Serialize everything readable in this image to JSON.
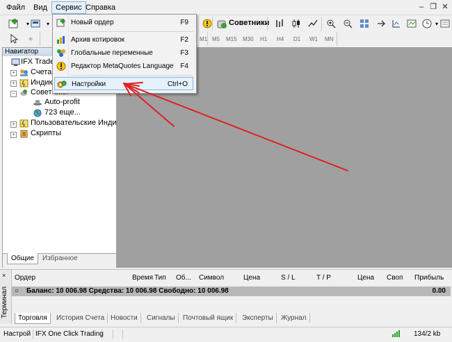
{
  "menubar": {
    "items": [
      "Файл",
      "Вид",
      "Сервис",
      "Справка"
    ]
  },
  "toolbar": {
    "experts_label": "Советники",
    "timeframes": [
      "M1",
      "M5",
      "M15",
      "M30",
      "H1",
      "H4",
      "D1",
      "W1",
      "MN"
    ]
  },
  "service_menu": {
    "items": [
      {
        "label": "Новый ордер",
        "shortcut": "F9",
        "icon": "new-order-icon"
      },
      {
        "label": "Архив котировок",
        "shortcut": "F2",
        "icon": "history-icon"
      },
      {
        "label": "Глобальные переменные",
        "shortcut": "F3",
        "icon": "global-vars-icon"
      },
      {
        "label": "Редактор MetaQuotes Language",
        "shortcut": "F4",
        "icon": "metaeditor-icon"
      },
      {
        "label": "Настройки",
        "shortcut": "Ctrl+O",
        "icon": "settings-icon"
      }
    ]
  },
  "navigator": {
    "title": "Навигатор",
    "tree": [
      {
        "label": "IFX Trader"
      },
      {
        "label": "Счета"
      },
      {
        "label": "Индик"
      },
      {
        "label": "Советники"
      },
      {
        "label": "Auto-profit"
      },
      {
        "label": "723 еще..."
      },
      {
        "label": "Пользовательские Индика"
      },
      {
        "label": "Скрипты"
      }
    ],
    "tabs": [
      "Общие",
      "Избранное"
    ]
  },
  "terminal": {
    "side_label": "Терминал",
    "columns": [
      "Ордер",
      "Время",
      "Тип",
      "Об...",
      "Символ",
      "Цена",
      "S / L",
      "T / P",
      "Цена",
      "Своп",
      "Прибыль"
    ],
    "balance_text": "Баланс: 10 006.98  Средства: 10 006.98  Свободно: 10 006.98",
    "balance_profit": "0.00",
    "tabs": [
      "Торговля",
      "История Счета",
      "Новости",
      "Сигналы",
      "Почтовый ящик",
      "Эксперты",
      "Журнал"
    ]
  },
  "statusbar": {
    "left": "Настрой",
    "profile": "IFX One Click Trading",
    "traffic": "134/2 kb"
  },
  "colors": {
    "chart_bg": "#a0a0a0",
    "arrow": "#e02020",
    "menu_highlight": "#e5f1fb"
  }
}
